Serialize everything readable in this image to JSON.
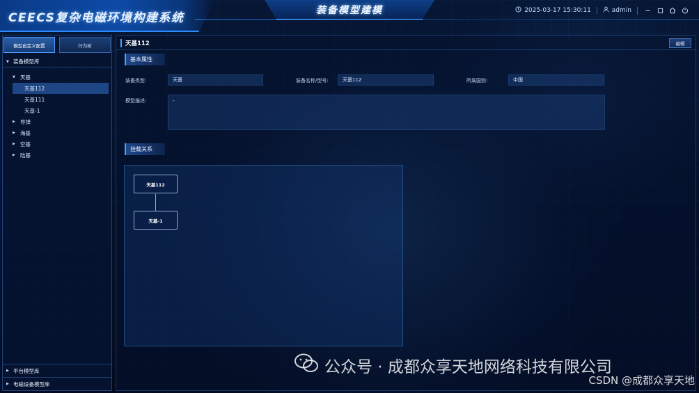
{
  "header": {
    "brand": "CEECS复杂电磁环境构建系统",
    "title": "装备模型建模",
    "datetime": "2025-03-17 15:30:11",
    "user": "admin"
  },
  "left": {
    "tabs": [
      {
        "label": "模型自定义配置",
        "active": true
      },
      {
        "label": "行为树",
        "active": false
      }
    ],
    "library": {
      "label": "装备模型库",
      "items": [
        {
          "label": "天基",
          "expanded": true,
          "children": [
            "天基112",
            "天基111",
            "天基-1"
          ],
          "selected": "天基112"
        },
        {
          "label": "导弹"
        },
        {
          "label": "海基"
        },
        {
          "label": "空基"
        },
        {
          "label": "陆基"
        }
      ]
    },
    "bottom_sections": [
      "平台模型库",
      "电磁设备模型库"
    ]
  },
  "main": {
    "title": "天基112",
    "edit_label": "编辑",
    "basic": {
      "section_label": "基本属性",
      "type_label": "装备类型:",
      "type_value": "天基",
      "name_label": "装备名称/型号:",
      "name_value": "天基112",
      "country_label": "所属国别:",
      "country_value": "中国",
      "desc_label": "模型描述:",
      "desc_value": "-"
    },
    "relation": {
      "section_label": "挂载关系",
      "parent_node": "天基112",
      "child_node": "天基-1"
    }
  },
  "watermark": {
    "main": "公众号 · 成都众享天地网络科技有限公司",
    "sub": "CSDN @成都众享天地"
  },
  "colors": {
    "accent": "#2f8cff",
    "selected_row": "#1e4584",
    "panel_border": "#326ebe"
  },
  "icons": [
    "clock-icon",
    "user-icon",
    "minimize-icon",
    "maximize-icon",
    "home-icon",
    "power-icon",
    "wechat-icon"
  ]
}
